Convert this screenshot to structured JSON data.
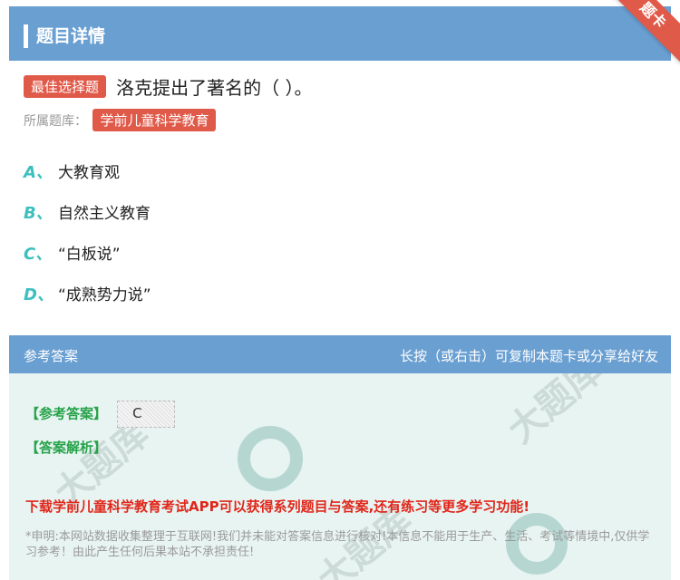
{
  "header": {
    "title": "题目详情",
    "ribbon": "题卡"
  },
  "question": {
    "type_badge": "最佳选择题",
    "text": "洛克提出了著名的（ ）。",
    "library_label": "所属题库：",
    "library_name": "学前儿童科学教育"
  },
  "options": [
    {
      "letter": "A、",
      "text": "大教育观"
    },
    {
      "letter": "B、",
      "text": "自然主义教育"
    },
    {
      "letter": "C、",
      "text": "“白板说”"
    },
    {
      "letter": "D、",
      "text": "“成熟势力说”"
    }
  ],
  "answer_panel": {
    "title": "参考答案",
    "hint": "长按（或右击）可复制本题卡或分享给好友",
    "answer_label": "【参考答案】",
    "answer_value": "C",
    "analysis_label": "【答案解析】",
    "promo": "下载学前儿童科学教育考试APP可以获得系列题目与答案,还有练习等更多学习功能!",
    "disclaimer": "*申明:本网站数据收集整理于互联网!我们并未能对答案信息进行核对!本信息不能用于生产、生活、考试等情境中,仅供学习参考！由此产生任何后果本站不承担责任!"
  },
  "colors": {
    "accent_blue": "#6a9fd2",
    "badge_red": "#e05a4a",
    "option_teal": "#3dbfbf",
    "answer_green": "#27a34a",
    "promo_red": "#e0261a"
  }
}
